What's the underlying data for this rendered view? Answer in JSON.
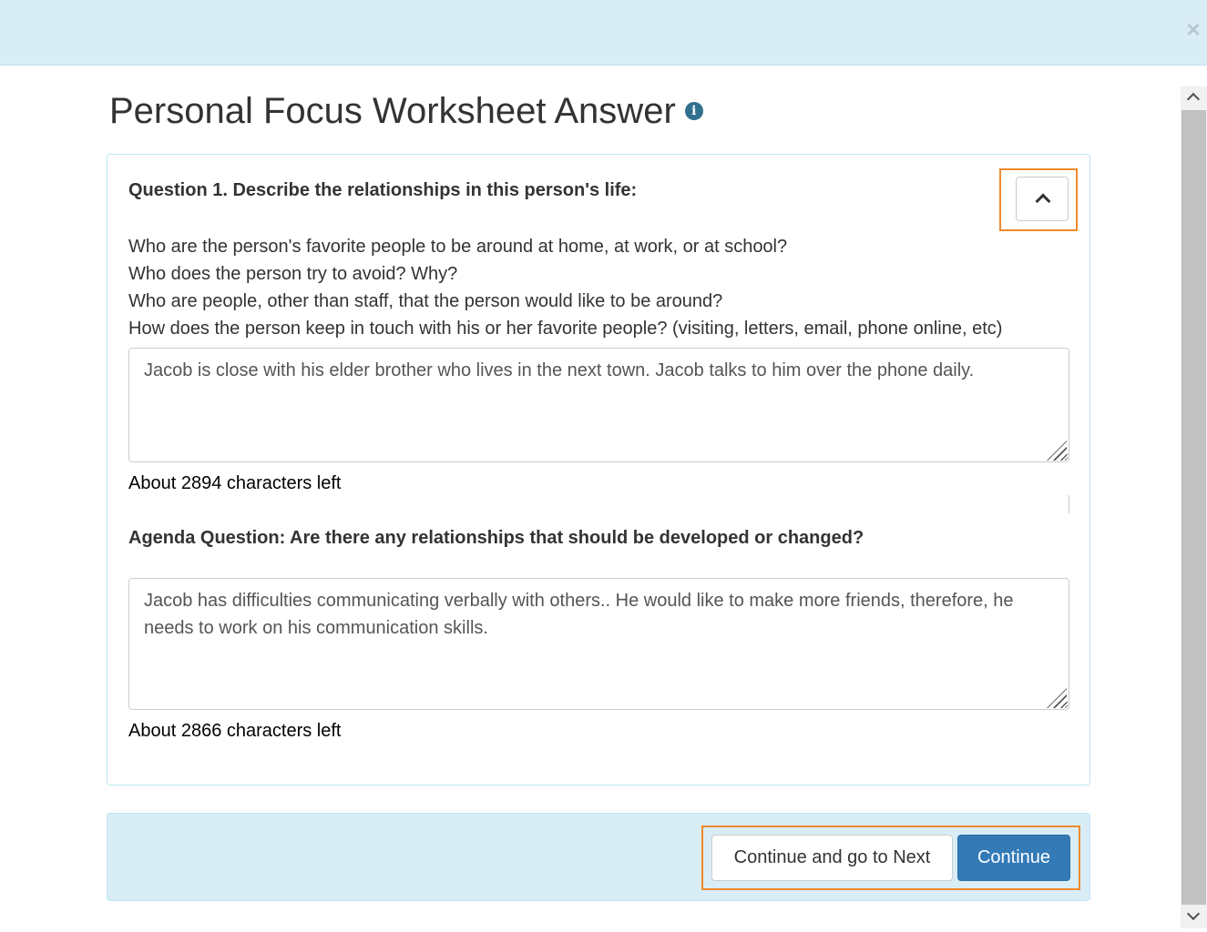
{
  "header": {
    "close_symbol": "×",
    "title": "Personal Focus Worksheet Answer",
    "info_icon": "i"
  },
  "question1": {
    "title": "Question 1. Describe the relationships in this person's life:",
    "prompts": [
      "Who are the person's favorite people to be around at home, at work, or at school?",
      "Who does the person try to avoid? Why?",
      "Who are people, other than staff, that the person would like to be around?",
      "How does the person keep in touch with his or her favorite people? (visiting, letters, email, phone online, etc)"
    ],
    "answer": "Jacob is close with his elder brother who lives in the next town. Jacob talks to him over the phone daily.",
    "chars_left": "About 2894 characters left"
  },
  "agenda": {
    "title": "Agenda Question: Are there any relationships that should be developed or changed?",
    "answer": "Jacob has difficulties communicating verbally with others.. He would like to make more friends, therefore, he needs to work on his communication skills.",
    "chars_left": "About 2866 characters left"
  },
  "footer": {
    "next_label": "Continue and go to Next",
    "continue_label": "Continue"
  },
  "colors": {
    "header_bg": "#d9edf7",
    "primary_button": "#337ab7",
    "highlight_outline": "#f0892b",
    "info_icon": "#31708f"
  }
}
